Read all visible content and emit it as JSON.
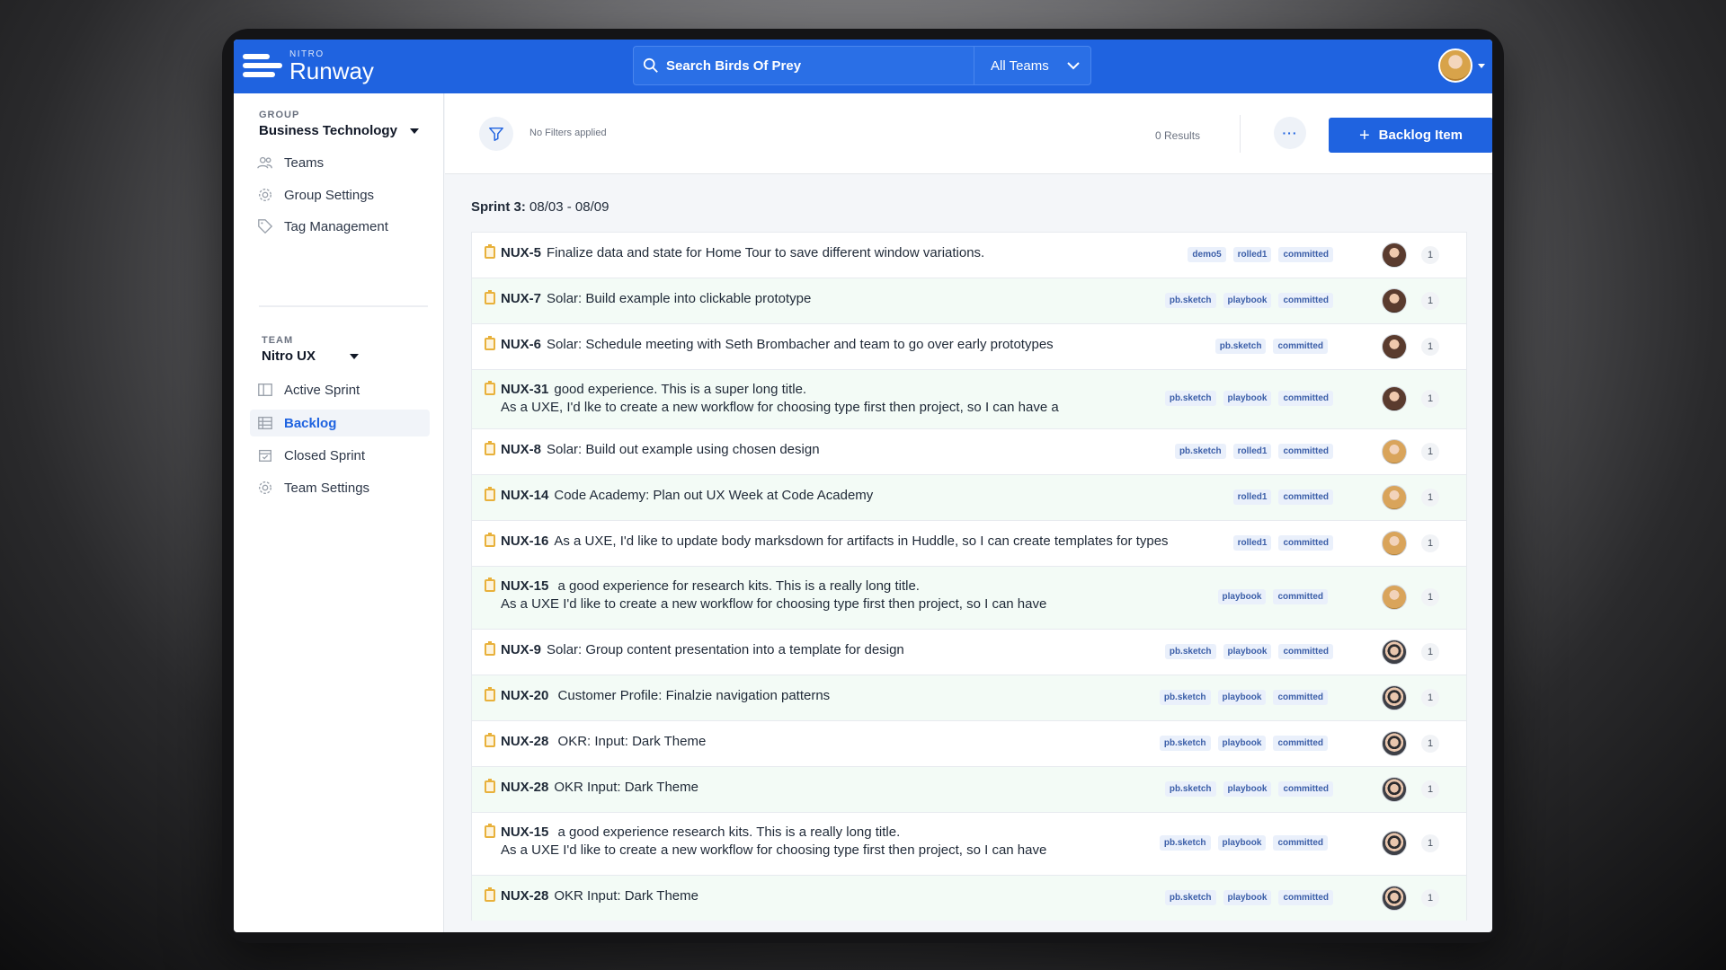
{
  "topbar": {
    "logo_small": "NITRO",
    "logo_big": "Runway",
    "search_placeholder": "Search Birds Of Prey",
    "team_select": "All Teams"
  },
  "sidebar": {
    "group_label": "GROUP",
    "group_value": "Business Technology",
    "group_items": [
      {
        "label": "Teams",
        "icon": "teams-icon"
      },
      {
        "label": "Group Settings",
        "icon": "gear-icon"
      },
      {
        "label": "Tag Management",
        "icon": "tag-icon"
      }
    ],
    "team_label": "TEAM",
    "team_value": "Nitro UX",
    "team_items": [
      {
        "label": "Active Sprint",
        "icon": "board-icon"
      },
      {
        "label": "Backlog",
        "icon": "table-icon",
        "active": true
      },
      {
        "label": "Closed Sprint",
        "icon": "calendar-check-icon"
      },
      {
        "label": "Team Settings",
        "icon": "gear-icon"
      }
    ]
  },
  "filterbar": {
    "filter_text": "No Filters applied",
    "results": "0 Results",
    "more_label": "···",
    "add_label": "Backlog Item"
  },
  "sprint": {
    "label": "Sprint 3:",
    "dates": "08/03 - 08/09"
  },
  "items": [
    {
      "key": "NUX-5",
      "title": "Finalize data and state for Home Tour to save different window variations.",
      "line2": "",
      "tags": [
        "demo5",
        "rolled1",
        "committed"
      ],
      "avatar": "f1",
      "points": "1"
    },
    {
      "key": "NUX-7",
      "title": "Solar: Build example into clickable prototype",
      "line2": "",
      "tags": [
        "pb.sketch",
        "playbook",
        "committed"
      ],
      "avatar": "f1",
      "points": "1"
    },
    {
      "key": "NUX-6",
      "title": "Solar: Schedule meeting with Seth Brombacher and team to go over early prototypes",
      "line2": "",
      "tags": [
        "pb.sketch",
        "committed"
      ],
      "avatar": "f1",
      "points": "1"
    },
    {
      "key": "NUX-31",
      "title": "good experience. This is a super long title.",
      "line2": "As a UXE, I'd lke to create a new workflow for choosing type first then project, so I can have a",
      "tags": [
        "pb.sketch",
        "playbook",
        "committed"
      ],
      "avatar": "f1",
      "points": "1"
    },
    {
      "key": "NUX-8",
      "title": "Solar: Build out example using chosen design",
      "line2": "",
      "tags": [
        "pb.sketch",
        "rolled1",
        "committed"
      ],
      "avatar": "f2",
      "points": "1"
    },
    {
      "key": "NUX-14",
      "title": "Code Academy: Plan out UX Week at Code Academy",
      "line2": "",
      "tags": [
        "rolled1",
        "committed"
      ],
      "avatar": "f2",
      "points": "1"
    },
    {
      "key": "NUX-16",
      "title": "As a UXE, I'd like to update body marksdown for artifacts in Huddle, so I can create templates for types",
      "line2": "",
      "tags": [
        "rolled1",
        "committed"
      ],
      "avatar": "f2",
      "points": "1"
    },
    {
      "key": "NUX-15",
      "title": " a good experience for research kits. This is a really long title.",
      "line2": "As a UXE I'd like to create a new workflow for choosing type first then project, so I can have",
      "tags": [
        "playbook",
        "committed"
      ],
      "avatar": "f2",
      "points": "1"
    },
    {
      "key": "NUX-9",
      "title": "Solar: Group content presentation into a template for design",
      "line2": "",
      "tags": [
        "pb.sketch",
        "playbook",
        "committed"
      ],
      "avatar": "m1",
      "points": "1"
    },
    {
      "key": "NUX-20",
      "title": " Customer Profile:  Finalzie navigation patterns",
      "line2": "",
      "tags": [
        "pb.sketch",
        "playbook",
        "committed"
      ],
      "avatar": "m1",
      "points": "1"
    },
    {
      "key": "NUX-28",
      "title": " OKR: Input: Dark Theme",
      "line2": "",
      "tags": [
        "pb.sketch",
        "playbook",
        "committed"
      ],
      "avatar": "m1",
      "points": "1"
    },
    {
      "key": "NUX-28",
      "title": "OKR Input: Dark Theme",
      "line2": "",
      "tags": [
        "pb.sketch",
        "playbook",
        "committed"
      ],
      "avatar": "m1",
      "points": "1"
    },
    {
      "key": "NUX-15",
      "title": " a good experience research kits. This is a really long title.",
      "line2": "As a UXE I'd like to create a new workflow for choosing type first then project, so I can have",
      "tags": [
        "pb.sketch",
        "playbook",
        "committed"
      ],
      "avatar": "m1",
      "points": "1"
    },
    {
      "key": "NUX-28",
      "title": "OKR Input: Dark Theme",
      "line2": "",
      "tags": [
        "pb.sketch",
        "playbook",
        "committed"
      ],
      "avatar": "m1",
      "points": "1"
    }
  ],
  "colors": {
    "brand": "#1f63e0",
    "alt_row": "#f3fbf6",
    "tag_text": "#3b5ea8"
  }
}
